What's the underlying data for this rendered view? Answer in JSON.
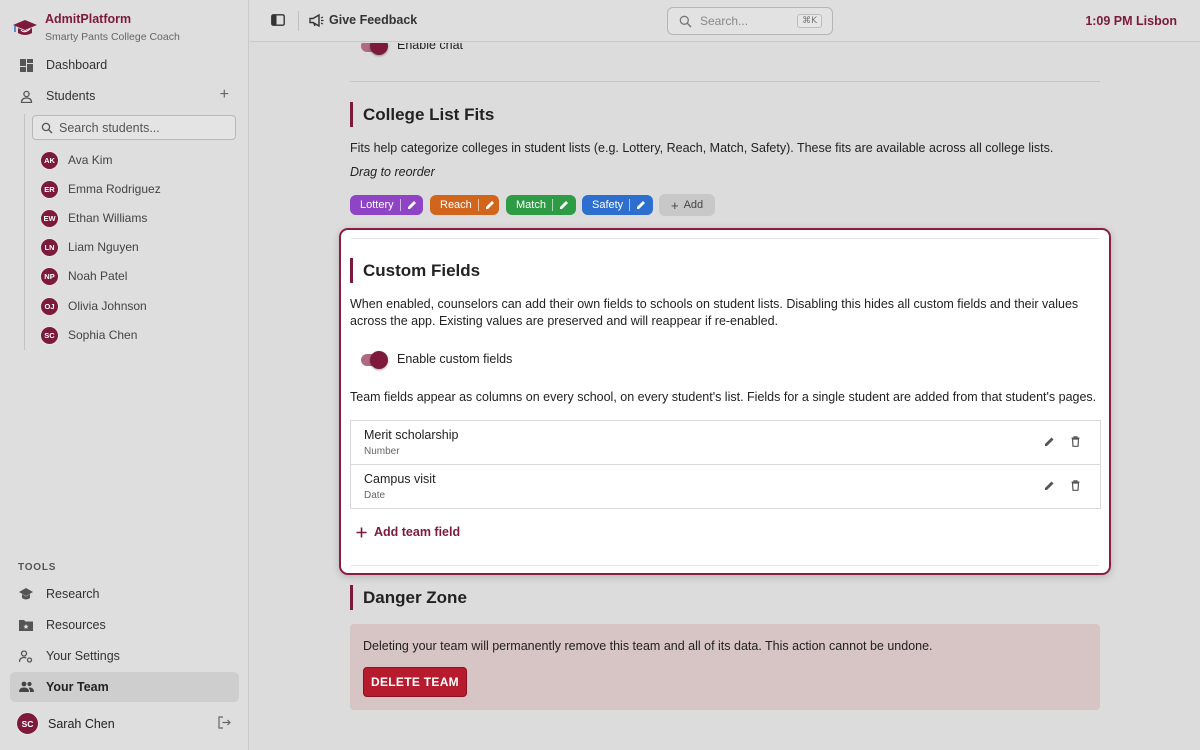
{
  "app": {
    "name": "AdmitPlatform",
    "subtitle": "Smarty Pants College Coach"
  },
  "sidebar": {
    "nav": [
      {
        "label": "Dashboard",
        "icon": "dashboard-icon"
      },
      {
        "label": "Students",
        "icon": "person-icon"
      }
    ],
    "student_search_placeholder": "Search students...",
    "students": [
      {
        "initials": "AK",
        "name": "Ava Kim"
      },
      {
        "initials": "ER",
        "name": "Emma Rodriguez"
      },
      {
        "initials": "EW",
        "name": "Ethan Williams"
      },
      {
        "initials": "LN",
        "name": "Liam Nguyen"
      },
      {
        "initials": "NP",
        "name": "Noah Patel"
      },
      {
        "initials": "OJ",
        "name": "Olivia Johnson"
      },
      {
        "initials": "SC",
        "name": "Sophia Chen"
      }
    ],
    "tools_label": "TOOLS",
    "tools": [
      {
        "label": "Research",
        "icon": "school-icon"
      },
      {
        "label": "Resources",
        "icon": "folder-icon"
      },
      {
        "label": "Your Settings",
        "icon": "person-settings-icon"
      },
      {
        "label": "Your Team",
        "icon": "group-icon",
        "active": true
      }
    ],
    "user": {
      "initials": "SC",
      "name": "Sarah Chen"
    }
  },
  "topbar": {
    "feedback_label": "Give Feedback",
    "search_placeholder": "Search...",
    "search_shortcut": "⌘K",
    "clock": "1:09 PM Lisbon"
  },
  "main": {
    "enable_chat_label": "Enable chat",
    "fits": {
      "title": "College List Fits",
      "description": "Fits help categorize colleges in student lists (e.g. Lottery, Reach, Match, Safety). These fits are available across all college lists.",
      "hint": "Drag to reorder",
      "chips": [
        {
          "label": "Lottery",
          "color": "#8e44c4"
        },
        {
          "label": "Reach",
          "color": "#d2651c"
        },
        {
          "label": "Match",
          "color": "#2e9b45"
        },
        {
          "label": "Safety",
          "color": "#2d6fce"
        }
      ],
      "add_label": "Add"
    },
    "custom_fields": {
      "title": "Custom Fields",
      "description": "When enabled, counselors can add their own fields to schools on student lists. Disabling this hides all custom fields and their values across the app. Existing values are preserved and will reappear if re-enabled.",
      "toggle_label": "Enable custom fields",
      "toggle_on": true,
      "team_note": "Team fields appear as columns on every school, on every student's list. Fields for a single student are added from that student's pages.",
      "fields": [
        {
          "name": "Merit scholarship",
          "type": "Number"
        },
        {
          "name": "Campus visit",
          "type": "Date"
        }
      ],
      "add_label": "Add team field"
    },
    "danger": {
      "title": "Danger Zone",
      "warning": "Deleting your team will permanently remove this team and all of its data. This action cannot be undone.",
      "button_label": "DELETE TEAM"
    }
  },
  "colors": {
    "brand": "#7d1a3c",
    "danger_button": "#b71c2e"
  }
}
